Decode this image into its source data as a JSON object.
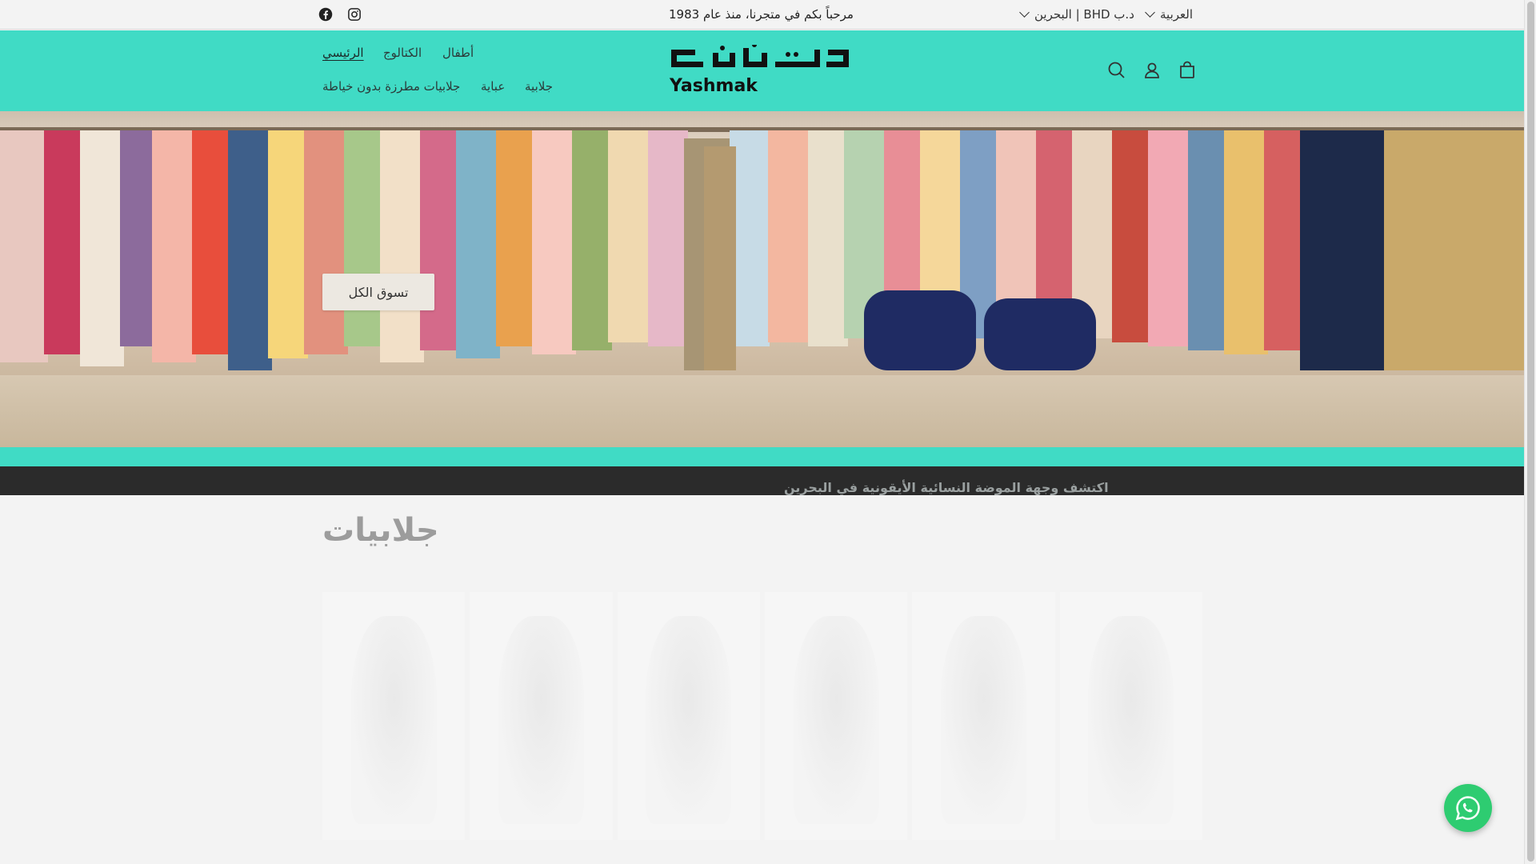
{
  "announcement": {
    "text": "مرحباً بكم في متجرنا، منذ عام 1983",
    "currency_label": "د.ب BHD | البحرين",
    "language_label": "العربية"
  },
  "social": [
    "facebook-icon",
    "instagram-icon"
  ],
  "nav": {
    "row1": [
      "الرئيسي",
      "الكتالوج",
      "أطفال"
    ],
    "row2": [
      "جلابيات مطرزة بدون خياطة",
      "عباية",
      "جلابية"
    ]
  },
  "logo": {
    "text_arabic": "يشمك",
    "text_latin": "Yashmak"
  },
  "header_icons": [
    "search-icon",
    "account-icon",
    "cart-icon"
  ],
  "hero": {
    "button_label": "تسوق الكل"
  },
  "marquee": {
    "text": "اكتشف وجهة الموضة النسائية الأيقونية في البحرين"
  },
  "collection": {
    "title": "جلابيات"
  },
  "colors": {
    "header_bg": "#40dbc5",
    "dark_band": "#2b2b2b",
    "whatsapp": "#2ecc71"
  }
}
